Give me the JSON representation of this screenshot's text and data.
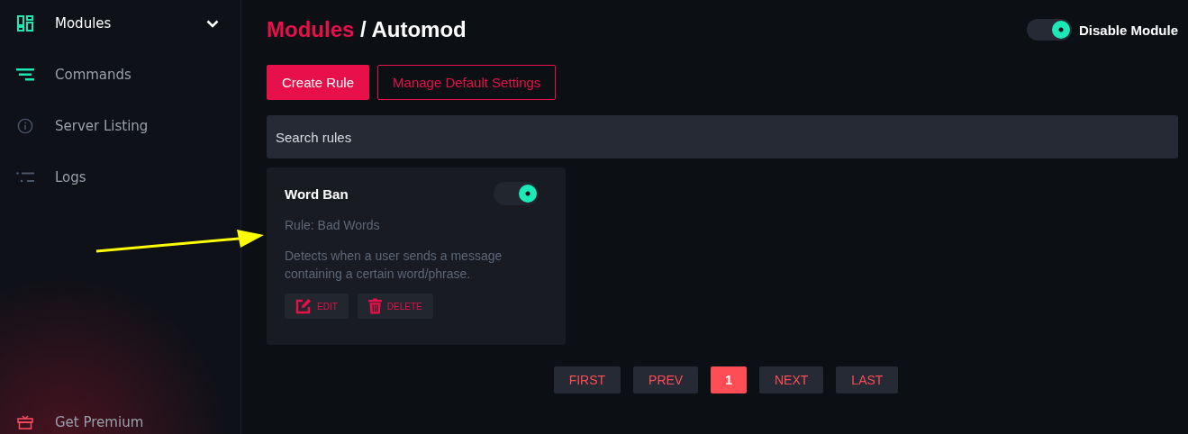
{
  "sidebar": {
    "items": [
      {
        "label": "Modules",
        "kind": "modules",
        "selected": true,
        "expanded": true
      },
      {
        "label": "Commands",
        "kind": "commands",
        "selected": false
      },
      {
        "label": "Server Listing",
        "kind": "info",
        "selected": false
      },
      {
        "label": "Logs",
        "kind": "logs",
        "selected": false
      }
    ],
    "premium": {
      "label": "Get Premium"
    }
  },
  "breadcrumb": {
    "parent": "Modules",
    "separator": "/",
    "current": "Automod"
  },
  "module_toggle": {
    "label": "Disable Module",
    "on": true
  },
  "actions": [
    {
      "label": "Create Rule",
      "kind": "primary"
    },
    {
      "label": "Manage Default Settings",
      "kind": "outline"
    }
  ],
  "search": {
    "placeholder": "Search rules"
  },
  "rules": [
    {
      "title": "Word Ban",
      "on": true,
      "rule": "Rule: Bad Words",
      "description": "Detects when a user sends a message containing a certain word/phrase.",
      "edit": "EDIT",
      "delete": "DELETE"
    }
  ],
  "pagination": [
    {
      "label": "FIRST",
      "selected": false
    },
    {
      "label": "PREV",
      "selected": false
    },
    {
      "label": "1",
      "selected": true
    },
    {
      "label": "NEXT",
      "selected": false
    },
    {
      "label": "LAST",
      "selected": false
    }
  ]
}
